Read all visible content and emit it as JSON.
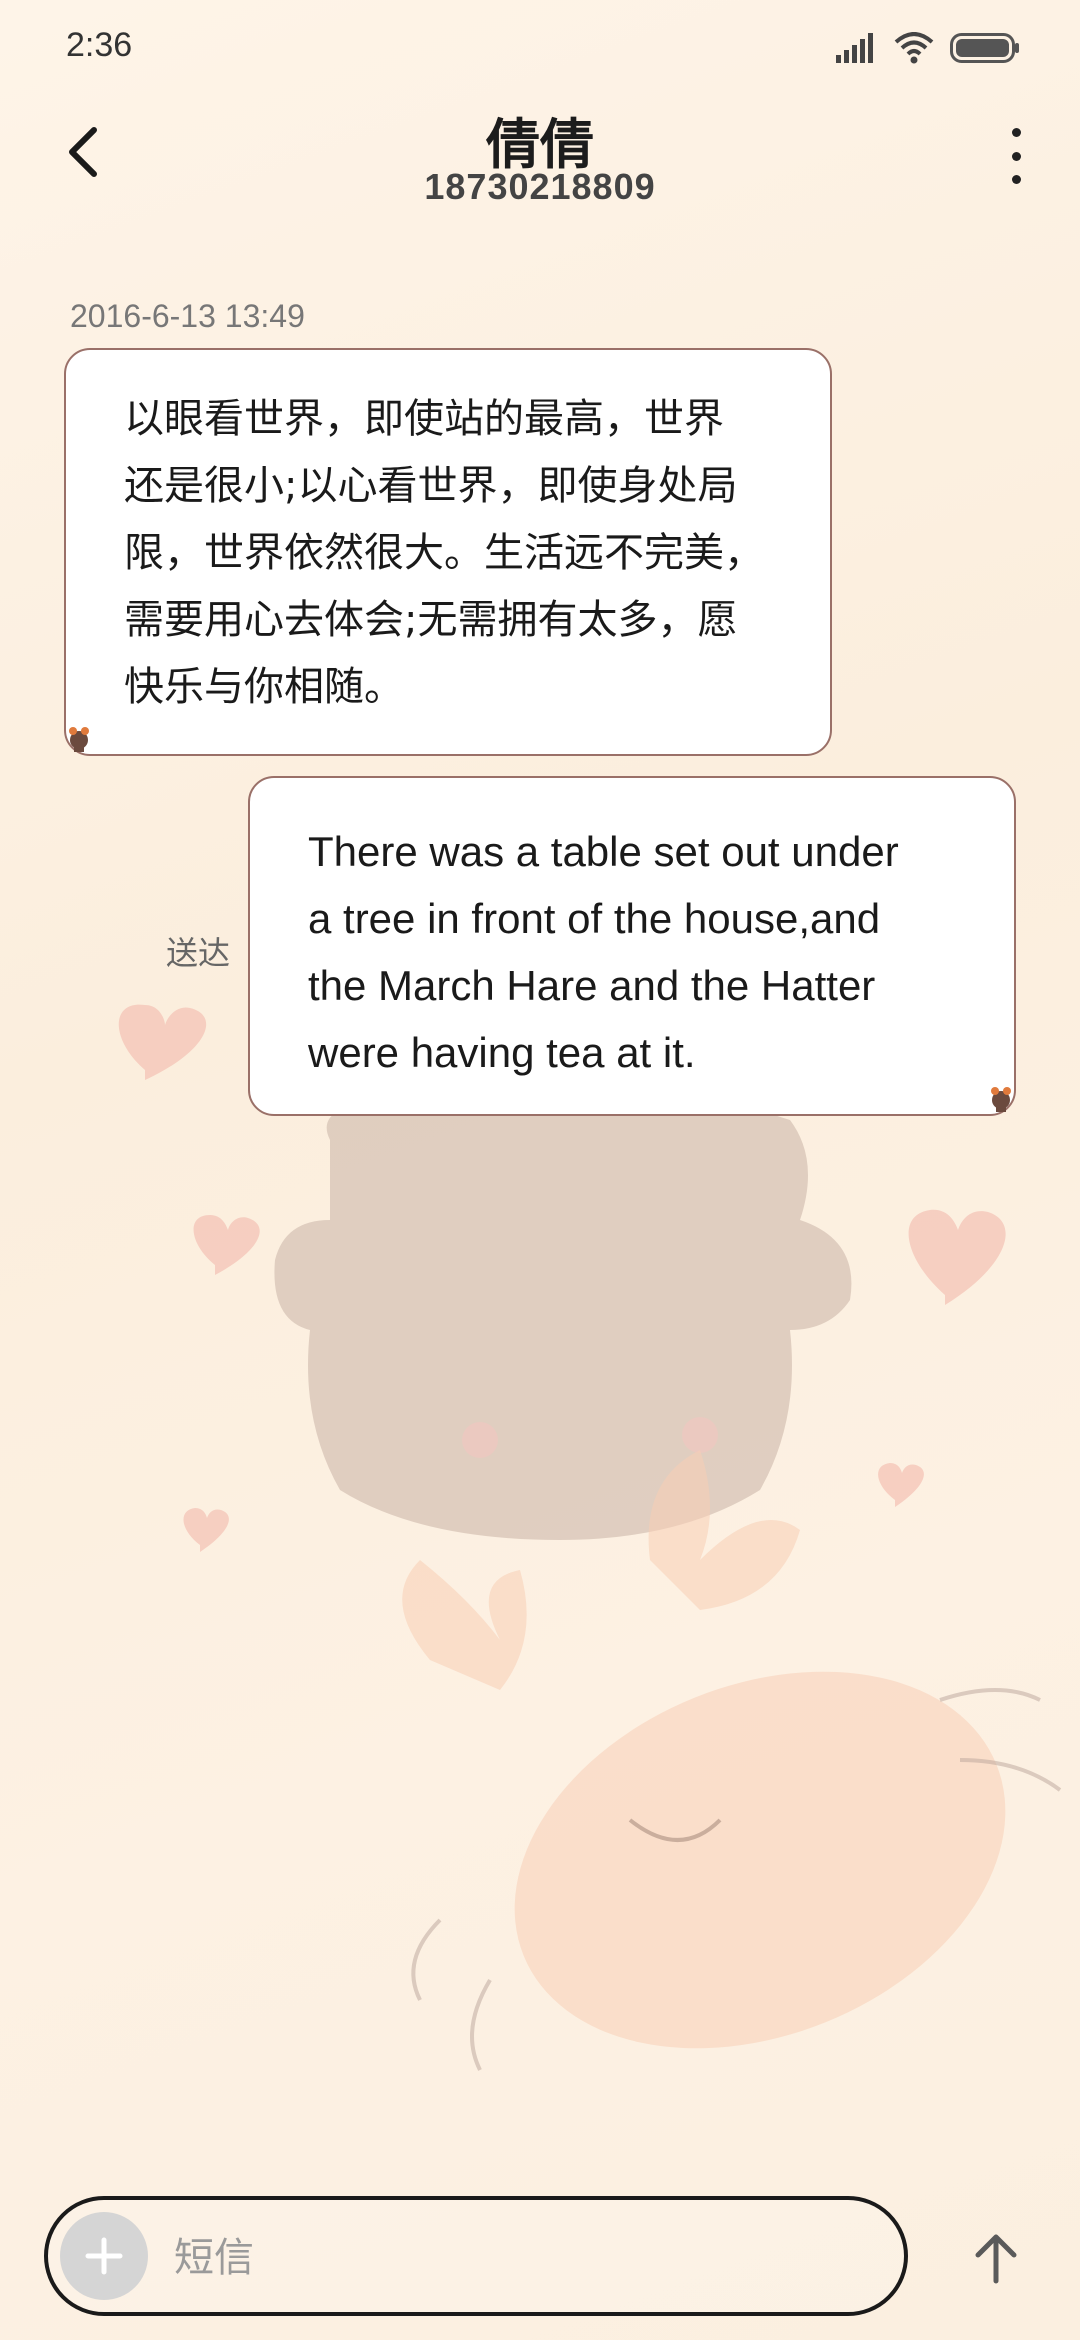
{
  "status_bar": {
    "time": "2:36",
    "icons": [
      "signal-icon",
      "wifi-icon",
      "battery-icon"
    ]
  },
  "header": {
    "back_icon": "chevron-left-icon",
    "contact_name": "倩倩",
    "contact_number": "18730218809",
    "more_icon": "more-vertical-icon"
  },
  "conversation": {
    "timestamp": "2016-6-13 13:49",
    "messages": [
      {
        "direction": "incoming",
        "lines": [
          "以眼看世界，即使站的最高，世界",
          "还是很小;以心看世界，即使身处局",
          "限，世界依然很大。生活远不完美，",
          "需要用心去体会;无需拥有太多，愿",
          "快乐与你相随。"
        ]
      },
      {
        "direction": "outgoing",
        "status": "送达",
        "lines": [
          "There was a table set out under",
          "a tree in front of the house,and",
          "the March Hare and the Hatter",
          "were having tea at it."
        ]
      }
    ]
  },
  "composer": {
    "add_icon": "plus-icon",
    "placeholder": "短信",
    "send_icon": "arrow-up-icon"
  },
  "colors": {
    "background": "#fdf2e4",
    "bubble_border": "#9a7068",
    "bubble_fill": "#ffffff"
  }
}
